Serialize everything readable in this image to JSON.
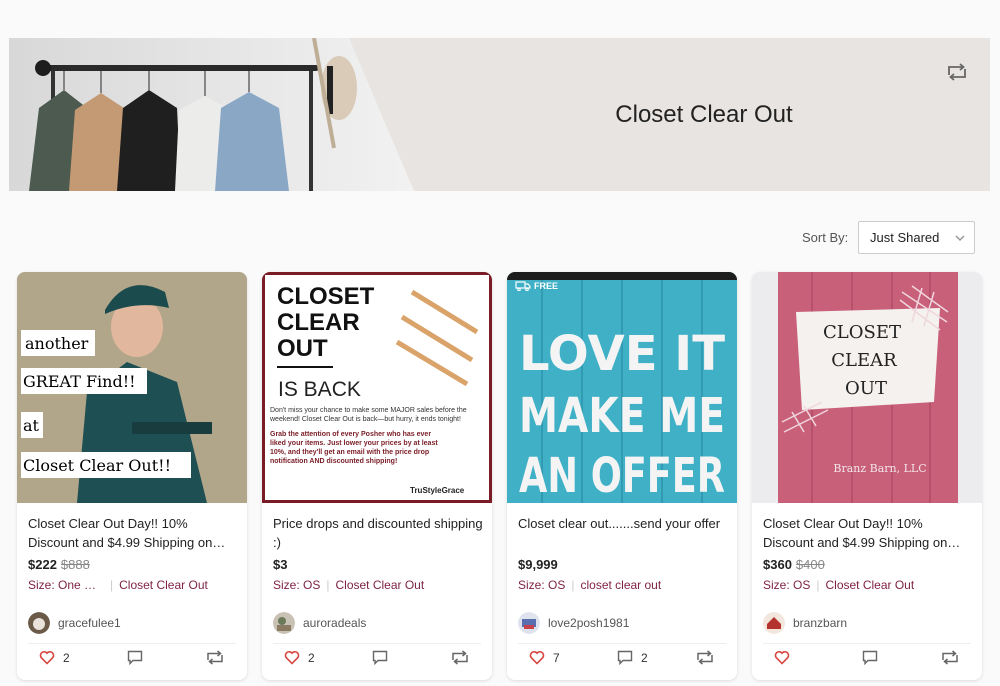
{
  "banner": {
    "title": "Closet Clear Out",
    "share_icon": "share-icon"
  },
  "sort": {
    "label": "Sort By:",
    "value": "Just Shared"
  },
  "colors": {
    "accent": "#7f2346",
    "heart": "#d7443e"
  },
  "listings": [
    {
      "title": "Closet Clear Out Day!! 10% Discount and $4.99 Shipping on…",
      "price": "$222",
      "original_price": "$888",
      "size": "Size: One Si…",
      "tag": "Closet Clear Out",
      "user": "gracefulee1",
      "likes": "2",
      "comments": "",
      "image_text": [
        "another",
        "GREAT Find!!",
        "at",
        "Closet Clear Out!!"
      ]
    },
    {
      "title": "Price drops and discounted shipping :)",
      "price": "$3",
      "original_price": "",
      "size": "Size: OS",
      "tag": "Closet Clear Out",
      "user": "auroradeals",
      "likes": "2",
      "comments": "",
      "image_text": {
        "headline": [
          "CLOSET",
          "CLEAR",
          "OUT"
        ],
        "sub": "IS BACK",
        "p1": "Don't miss your chance to make some MAJOR sales before the weekend! Closet Clear Out is back—but hurry, it ends tonight!",
        "p2": "Grab the attention of every Posher who has ever liked your items. Just lower your prices by at least 10%, and they'll get an email with the price drop notification AND discounted shipping!",
        "brand": "TruStyleGrace"
      }
    },
    {
      "title": "Closet clear out.......send your offer",
      "price": "$9,999",
      "original_price": "",
      "size": "Size: OS",
      "tag": "closet clear out",
      "user": "love2posh1981",
      "likes": "7",
      "comments": "2",
      "badge": "FREE",
      "image_text": [
        "LOVE IT",
        "MAKE ME",
        "AN OFFER"
      ]
    },
    {
      "title": "Closet Clear Out Day!! 10% Discount and $4.99 Shipping on…",
      "price": "$360",
      "original_price": "$400",
      "size": "Size: OS",
      "tag": "Closet Clear Out",
      "user": "branzbarn",
      "likes": "",
      "comments": "",
      "image_text": [
        "CLOSET",
        "CLEAR",
        "OUT",
        "Branz Barn, LLC"
      ]
    }
  ]
}
